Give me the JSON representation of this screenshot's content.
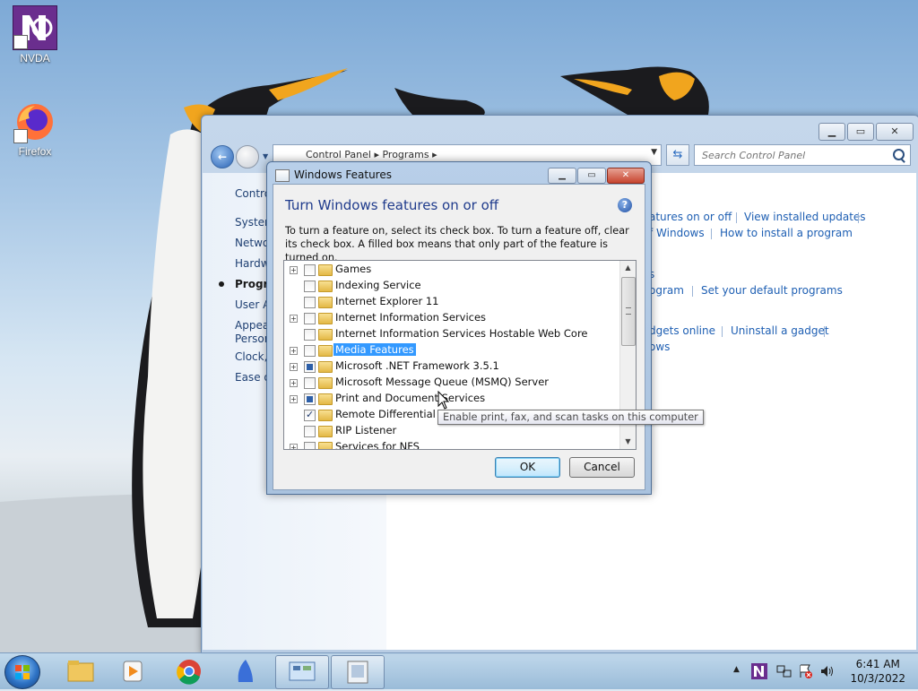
{
  "desktop": {
    "icons": [
      {
        "label": "NVDA"
      },
      {
        "label": "Firefox"
      }
    ]
  },
  "control_panel": {
    "breadcrumb": [
      "Control Panel",
      "Programs"
    ],
    "search_placeholder": "Search Control Panel",
    "nav": {
      "item_control": "Contro",
      "item_system": "System",
      "item_network": "Netwo",
      "item_hardware": "Hardw",
      "item_programs": "Progra",
      "item_user": "User Ac",
      "item_appearance_1": "Appear",
      "item_appearance_2": "Person",
      "item_clock": "Clock, ",
      "item_ease": "Ease of"
    },
    "links": {
      "features": "atures on or off",
      "view_updates": "View installed updates",
      "windows": "f Windows",
      "how_install": "How to install a program",
      "s": "s",
      "program": "ogram",
      "default_programs": "Set your default programs",
      "gadgets_online": "dgets online",
      "uninstall_gadget": "Uninstall a gadget",
      "ows": "ows"
    }
  },
  "dialog": {
    "title": "Windows Features",
    "heading": "Turn Windows features on or off",
    "description": "To turn a feature on, select its check box. To turn a feature off, clear its check box. A filled box means that only part of the feature is turned on.",
    "features": [
      {
        "label": "Games",
        "expandable": true,
        "state": "unchecked",
        "selected": false
      },
      {
        "label": "Indexing Service",
        "expandable": false,
        "state": "unchecked",
        "selected": false
      },
      {
        "label": "Internet Explorer 11",
        "expandable": false,
        "state": "unchecked",
        "selected": false
      },
      {
        "label": "Internet Information Services",
        "expandable": true,
        "state": "unchecked",
        "selected": false
      },
      {
        "label": "Internet Information Services Hostable Web Core",
        "expandable": false,
        "state": "unchecked",
        "selected": false
      },
      {
        "label": "Media Features",
        "expandable": true,
        "state": "unchecked",
        "selected": true
      },
      {
        "label": "Microsoft .NET Framework 3.5.1",
        "expandable": true,
        "state": "partial",
        "selected": false
      },
      {
        "label": "Microsoft Message Queue (MSMQ) Server",
        "expandable": true,
        "state": "unchecked",
        "selected": false
      },
      {
        "label": "Print and Document Services",
        "expandable": true,
        "state": "partial",
        "selected": false
      },
      {
        "label": "Remote Differential Co",
        "expandable": false,
        "state": "checked",
        "selected": false
      },
      {
        "label": "RIP Listener",
        "expandable": false,
        "state": "unchecked",
        "selected": false
      },
      {
        "label": "Services for NFS",
        "expandable": true,
        "state": "unchecked",
        "selected": false
      }
    ],
    "ok_label": "OK",
    "cancel_label": "Cancel",
    "tooltip": "Enable print, fax, and scan tasks on this computer"
  },
  "taskbar": {
    "clock_time": "6:41 AM",
    "clock_date": "10/3/2022"
  },
  "colors": {
    "link": "#1e5fb3",
    "heading": "#1f3b8c",
    "selection": "#3399ff"
  }
}
